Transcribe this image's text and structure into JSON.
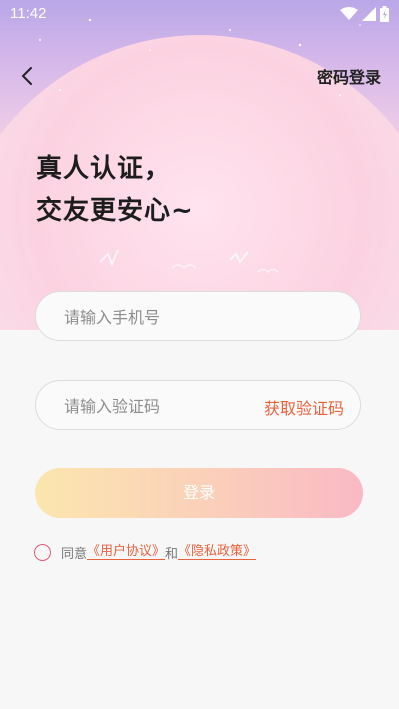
{
  "status": {
    "time": "11:42"
  },
  "header": {
    "password_login": "密码登录"
  },
  "headline": {
    "line1": "真人认证，",
    "line2": "交友更安心~"
  },
  "phone_field": {
    "placeholder": "请输入手机号"
  },
  "code_field": {
    "placeholder": "请输入验证码",
    "get_code": "获取验证码"
  },
  "login": {
    "label": "登录"
  },
  "agreement": {
    "prefix": "同意",
    "user_agreement": "《用户协议》",
    "conjunction": "和",
    "privacy_policy": "《隐私政策》"
  },
  "icons": {
    "wifi": "wifi-icon",
    "signal": "signal-icon",
    "battery": "battery-icon",
    "back": "chevron-left-icon",
    "checkbox": "radio-circle-icon"
  },
  "colors": {
    "accent": "#e8623c",
    "radio": "#e05a78",
    "button_start": "#fbe6ae",
    "button_end": "#f9b9c5"
  }
}
